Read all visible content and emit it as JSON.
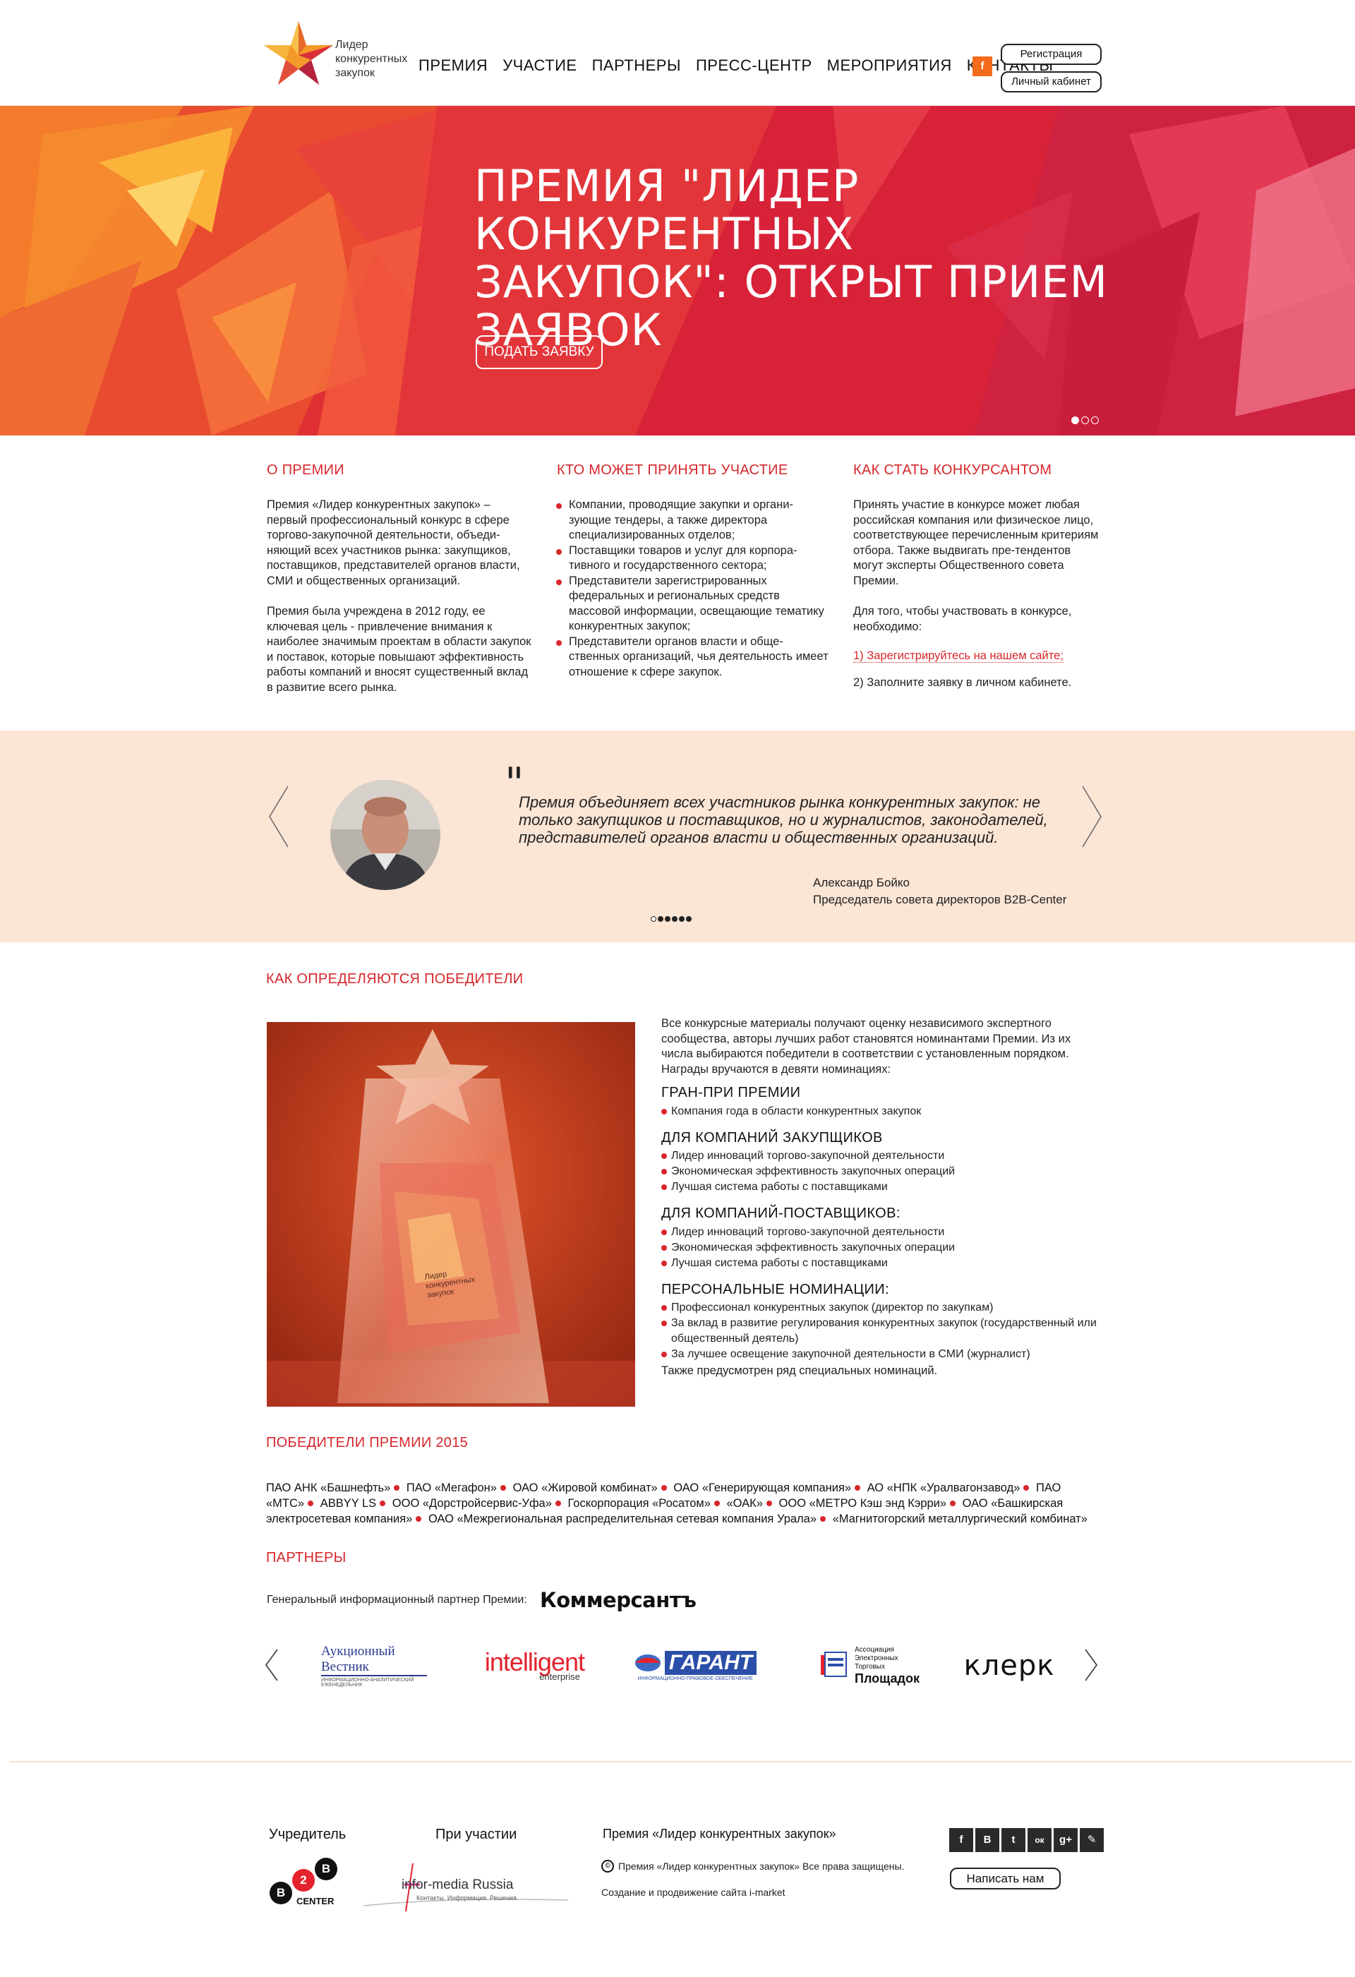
{
  "header": {
    "logo_text": "Лидер конкурентных закупок",
    "nav": [
      "ПРЕМИЯ",
      "УЧАСТИЕ",
      "ПАРТНЕРЫ",
      "ПРЕСС-ЦЕНТР",
      "МЕРОПРИЯТИЯ",
      "КОНТАКТЫ"
    ],
    "facebook_label": "f",
    "register_label": "Регистрация",
    "cabinet_label": "Личный кабинет"
  },
  "hero": {
    "title": "ПРЕМИЯ \"ЛИДЕР КОНКУРЕНТНЫХ ЗАКУПОК\": ОТКРЫТ ПРИЕМ ЗАЯВОК",
    "button_label": "ПОДАТЬ ЗАЯВКУ",
    "slide_count": 3,
    "active_slide": 1
  },
  "about": {
    "title": "О ПРЕМИИ",
    "p1": "Премия «Лидер конкурентных закупок» – первый профессиональный конкурс в сфере торгово-закупочной деятельности, объеди-няющий всех участников рынка: закупщиков, поставщиков, представителей органов власти, СМИ и общественных организаций.",
    "p2": "Премия была учреждена в 2012 году, ее ключевая цель - привлечение внимания к наиболее значимым проектам в области закупок и поставок, которые повышают эффективность работы компаний и вносят существенный вклад в развитие всего рынка."
  },
  "who": {
    "title": "КТО МОЖЕТ ПРИНЯТЬ УЧАСТИЕ",
    "items": [
      "Компании, проводящие закупки и органи-зующие тендеры, а также директора специализированных отделов;",
      "Поставщики товаров и услуг для корпора-тивного и государственного сектора;",
      "Представители зарегистрированных федеральных и региональных средств массовой информации, освещающие тематику конкурентных закупок;",
      "Представители органов власти и обще-ственных организаций, чья деятельность имеет отношение к сфере закупок."
    ]
  },
  "how": {
    "title": "КАК СТАТЬ КОНКУРСАНТОМ",
    "p1": "Принять участие в конкурсе может любая российская компания или физическое лицо, соответствующее перечисленным критериям отбора. Также выдвигать пре-тендентов могут эксперты Общественного совета Премии.",
    "p2": "Для того, чтобы участвовать в конкурсе, необходимо:",
    "step1": "1) Зарегистрируйтесь на нашем сайте;",
    "step2": "2) Заполните заявку в личном кабинете."
  },
  "quote": {
    "mark": "\"",
    "text": "Премия объединяет всех участников рынка конкурентных закупок: не только закупщиков и поставщиков,  но и журналистов, законодателей, представителей органов власти и общественных организаций.",
    "author": "Александр Бойко",
    "position": "Председатель совета директоров B2B-Center",
    "slide_count": 6,
    "active_slide": 1
  },
  "judging": {
    "title": "КАК ОПРЕДЕЛЯЮТСЯ ПОБЕДИТЕЛИ",
    "trophy_text": "Лидер конкурентных закупок",
    "intro": "Все конкурсные материалы получают оценку независимого экспертного сообщества, авторы лучших работ становятся номинантами Премии. Из их числа выбираются победители в соответствии с установленным порядком. Награды вручаются в девяти номинациях:",
    "groups": [
      {
        "title": "ГРАН-ПРИ ПРЕМИИ",
        "items": [
          "Компания года в области конкурентных закупок"
        ]
      },
      {
        "title": "ДЛЯ КОМПАНИЙ ЗАКУПЩИКОВ",
        "items": [
          "Лидер инноваций торгово-закупочной деятельности",
          "Экономическая эффективность закупочных операций",
          "Лучшая система работы с поставщиками"
        ]
      },
      {
        "title": "ДЛЯ КОМПАНИЙ-ПОСТАВЩИКОВ:",
        "items": [
          "Лидер инноваций торгово-закупочной деятельности",
          "Экономическая эффективность закупочных операции",
          "Лучшая система работы с поставщиками"
        ]
      },
      {
        "title": "ПЕРСОНАЛЬНЫЕ НОМИНАЦИИ:",
        "items": [
          "Профессионал конкурентных закупок (директор по закупкам)",
          "За вклад в развитие регулирования конкурентных закупок (государственный или общественный деятель)",
          "За лучшее освещение закупочной деятельности в СМИ (журналист)"
        ]
      }
    ],
    "outro": "Также предусмотрен ряд специальных номинаций."
  },
  "winners": {
    "title": "ПОБЕДИТЕЛИ ПРЕМИИ 2015",
    "list": [
      "ПАО АНК «Башнефть»",
      "ПАО «Мегафон»",
      "ОАО «Жировой комбинат»",
      "ОАО «Генерирующая компания»",
      "АО «НПК «Уралвагонзавод»",
      "ПАО «МТС»",
      "ABBYY LS",
      "ООО «Дорстройсервис-Уфа»",
      "Госкорпорация «Росатом»",
      "«ОАК»",
      "ООО «МЕТРО Кэш энд Кэрри»",
      "ОАО «Башкирская электросетевая компания»",
      "ОАО «Межрегиональная распределительная сетевая компания Урала»",
      "«Магнитогорский металлургический комбинат»"
    ]
  },
  "partners": {
    "title": "ПАРТНЕРЫ",
    "general_label": "Генеральный информационный партнер Премии:",
    "general_name": "Коммерсантъ",
    "logos": [
      {
        "name": "Аукционный Вестник",
        "sub": "ИНФОРМАЦИОННО-АНАЛИТИЧЕСКИЙ ЕЖЕНЕДЕЛЬНИК"
      },
      {
        "name": "intelligent",
        "sub": "enterprise"
      },
      {
        "name": "ГАРАНТ",
        "sub": "ИНФОРМАЦИОННО-ПРАВОВОЕ ОБЕСПЕЧЕНИЕ"
      },
      {
        "name": "Площадок",
        "sub": "Ассоциация Электронных Торговых"
      },
      {
        "name": "клерк",
        "sub": ""
      }
    ]
  },
  "footer": {
    "founder_title": "Учредитель",
    "founder_logo": "CENTER",
    "founder_b1": "B",
    "founder_2": "2",
    "founder_b2": "B",
    "participation_title": "При участии",
    "participation_logo": "infor-media Russia",
    "participation_sub": "Контакты. Информация. Решения.",
    "premium_title": "Премия «Лидер конкурентных закупок»",
    "copyright": "Премия «Лидер конкурентных закупок» Все права защищены.",
    "credits": "Создание и продвижение сайта i-market",
    "social": [
      "f",
      "В",
      "t",
      "ок",
      "g+",
      "✎"
    ],
    "write_label": "Написать нам"
  }
}
